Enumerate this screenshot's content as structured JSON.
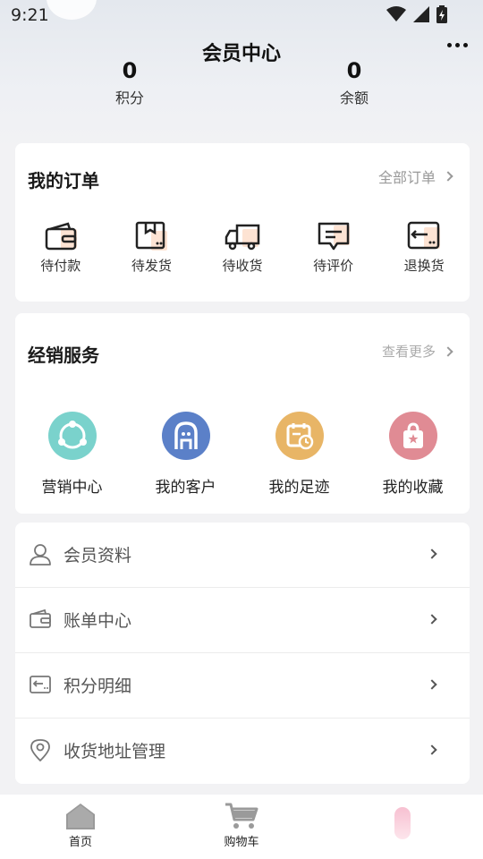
{
  "status_bar": {
    "time": "9:21"
  },
  "header": {
    "title": "会员中心"
  },
  "stats": [
    {
      "value": "0",
      "label": "积分"
    },
    {
      "value": "0",
      "label": "余额"
    }
  ],
  "orders": {
    "title": "我的订单",
    "link": "全部订单",
    "items": [
      {
        "label": "待付款",
        "icon": "wallet-icon"
      },
      {
        "label": "待发货",
        "icon": "package-icon"
      },
      {
        "label": "待收货",
        "icon": "truck-icon"
      },
      {
        "label": "待评价",
        "icon": "comment-icon"
      },
      {
        "label": "退换货",
        "icon": "return-icon"
      }
    ]
  },
  "service": {
    "title": "经销服务",
    "link": "查看更多",
    "items": [
      {
        "label": "营销中心",
        "icon": "share-network-icon",
        "color": "#6fcfc8"
      },
      {
        "label": "我的客户",
        "icon": "customer-icon",
        "color": "#5b80c8"
      },
      {
        "label": "我的足迹",
        "icon": "calendar-clock-icon",
        "color": "#e5b25e"
      },
      {
        "label": "我的收藏",
        "icon": "favorite-bag-icon",
        "color": "#e08b94"
      }
    ]
  },
  "menu": [
    {
      "label": "会员资料",
      "icon": "user-icon"
    },
    {
      "label": "账单中心",
      "icon": "wallet-icon"
    },
    {
      "label": "积分明细",
      "icon": "points-icon"
    },
    {
      "label": "收货地址管理",
      "icon": "location-icon"
    }
  ],
  "tabbar": {
    "home": "首页",
    "cart": "购物车"
  }
}
